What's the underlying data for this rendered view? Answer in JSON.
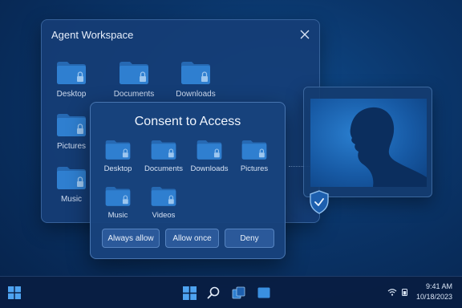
{
  "workspace": {
    "title": "Agent Workspace",
    "folders": [
      {
        "label": "Desktop",
        "icon": "folder-lock-icon"
      },
      {
        "label": "Documents",
        "icon": "folder-lock-icon"
      },
      {
        "label": "Downloads",
        "icon": "folder-lock-icon"
      },
      {
        "label": "Pictures",
        "icon": "folder-lock-icon"
      },
      {
        "label": "Music",
        "icon": "folder-lock-icon"
      }
    ]
  },
  "consent": {
    "title": "Consent to Access",
    "folders": [
      {
        "label": "Desktop"
      },
      {
        "label": "Documents"
      },
      {
        "label": "Downloads"
      },
      {
        "label": "Pictures"
      },
      {
        "label": "Music"
      },
      {
        "label": "Videos"
      }
    ],
    "buttons": {
      "always_allow": "Always allow",
      "allow_once": "Allow once",
      "deny": "Deny"
    }
  },
  "taskbar": {
    "time": "9:41 AM",
    "date": "10/18/2023"
  },
  "colors": {
    "folder": "#2f7fd0",
    "folder_tab": "#2669b3",
    "accent": "#3d8fe0"
  }
}
